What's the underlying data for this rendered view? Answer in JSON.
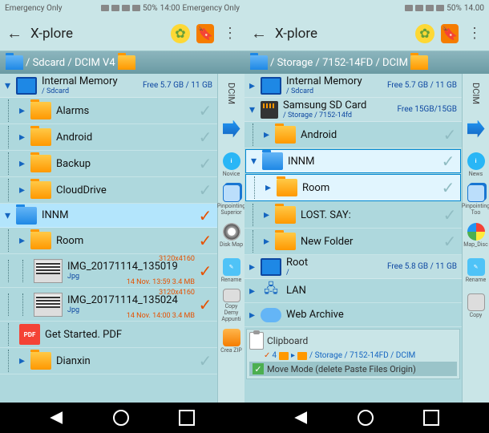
{
  "status": {
    "left": "Emergency Only",
    "battery": "50%",
    "time_c": "14:00",
    "time_d": "14.00"
  },
  "app": {
    "title": "X-plore"
  },
  "left": {
    "path": " / Sdcard / DCIM V4",
    "storage_title": "Internal Memory",
    "storage_sub": "/ Sdcard",
    "storage_free": "Free 5.7 GB / 11 GB",
    "folders": {
      "alarms": "Alarms",
      "android": "Android",
      "backup": "Backup",
      "clouddrive": "CloudDrive",
      "innm": "INNM",
      "room": "Room",
      "dianxin": "Dianxin"
    },
    "thumbs": {
      "dim": "3120x4160",
      "img1": "IMG_20171114_135019",
      "img1_ext": "Jpg",
      "img1_meta": "14 Nov. 13:59 3.4 MB",
      "img2": "IMG_20171114_135024",
      "img2_ext": "Jpg",
      "img2_meta": "14 Nov. 14:00 3.4 MB"
    },
    "pdf": "Get Started. PDF"
  },
  "right": {
    "path": " / Storage / 7152-14FD / DCIM",
    "storage_title": "Internal Memory",
    "storage_sub": "/ Sdcard",
    "storage_free": "Free 5.7 GB / 11 GB",
    "sd_title": "Samsung SD Card",
    "sd_sub": "/ Storage / 7152-14fd",
    "sd_free": "Free 15GB/15GB",
    "folders": {
      "android": "Android",
      "innm": "INNM",
      "room": "Room",
      "lost": "LOST. SAY:",
      "newfolder": "New Folder"
    },
    "root_title": "Root",
    "root_sub": "/",
    "root_free": "Free 5.8 GB / 11 GB",
    "lan": "LAN",
    "web": "Web Archive",
    "clipboard": {
      "title": "Clipboard",
      "count": "4",
      "dest": "/ Storage / 7152-14FD / DCIM",
      "mode": "Move Mode (delete Paste Files Origin)"
    }
  },
  "sidebar": {
    "dcim": "DCIM",
    "novice": "Novice",
    "superior": "Pinpointing Superior",
    "diskmap": "Disk Map",
    "rename": "Rename",
    "copy2": "Copy Demy Appunti",
    "createzip": "Crea ZIP",
    "news": "News",
    "too": "Pinpointing Too",
    "mapdisc": "Map_Disc",
    "rename2": "Rename",
    "copy": "Copy"
  }
}
